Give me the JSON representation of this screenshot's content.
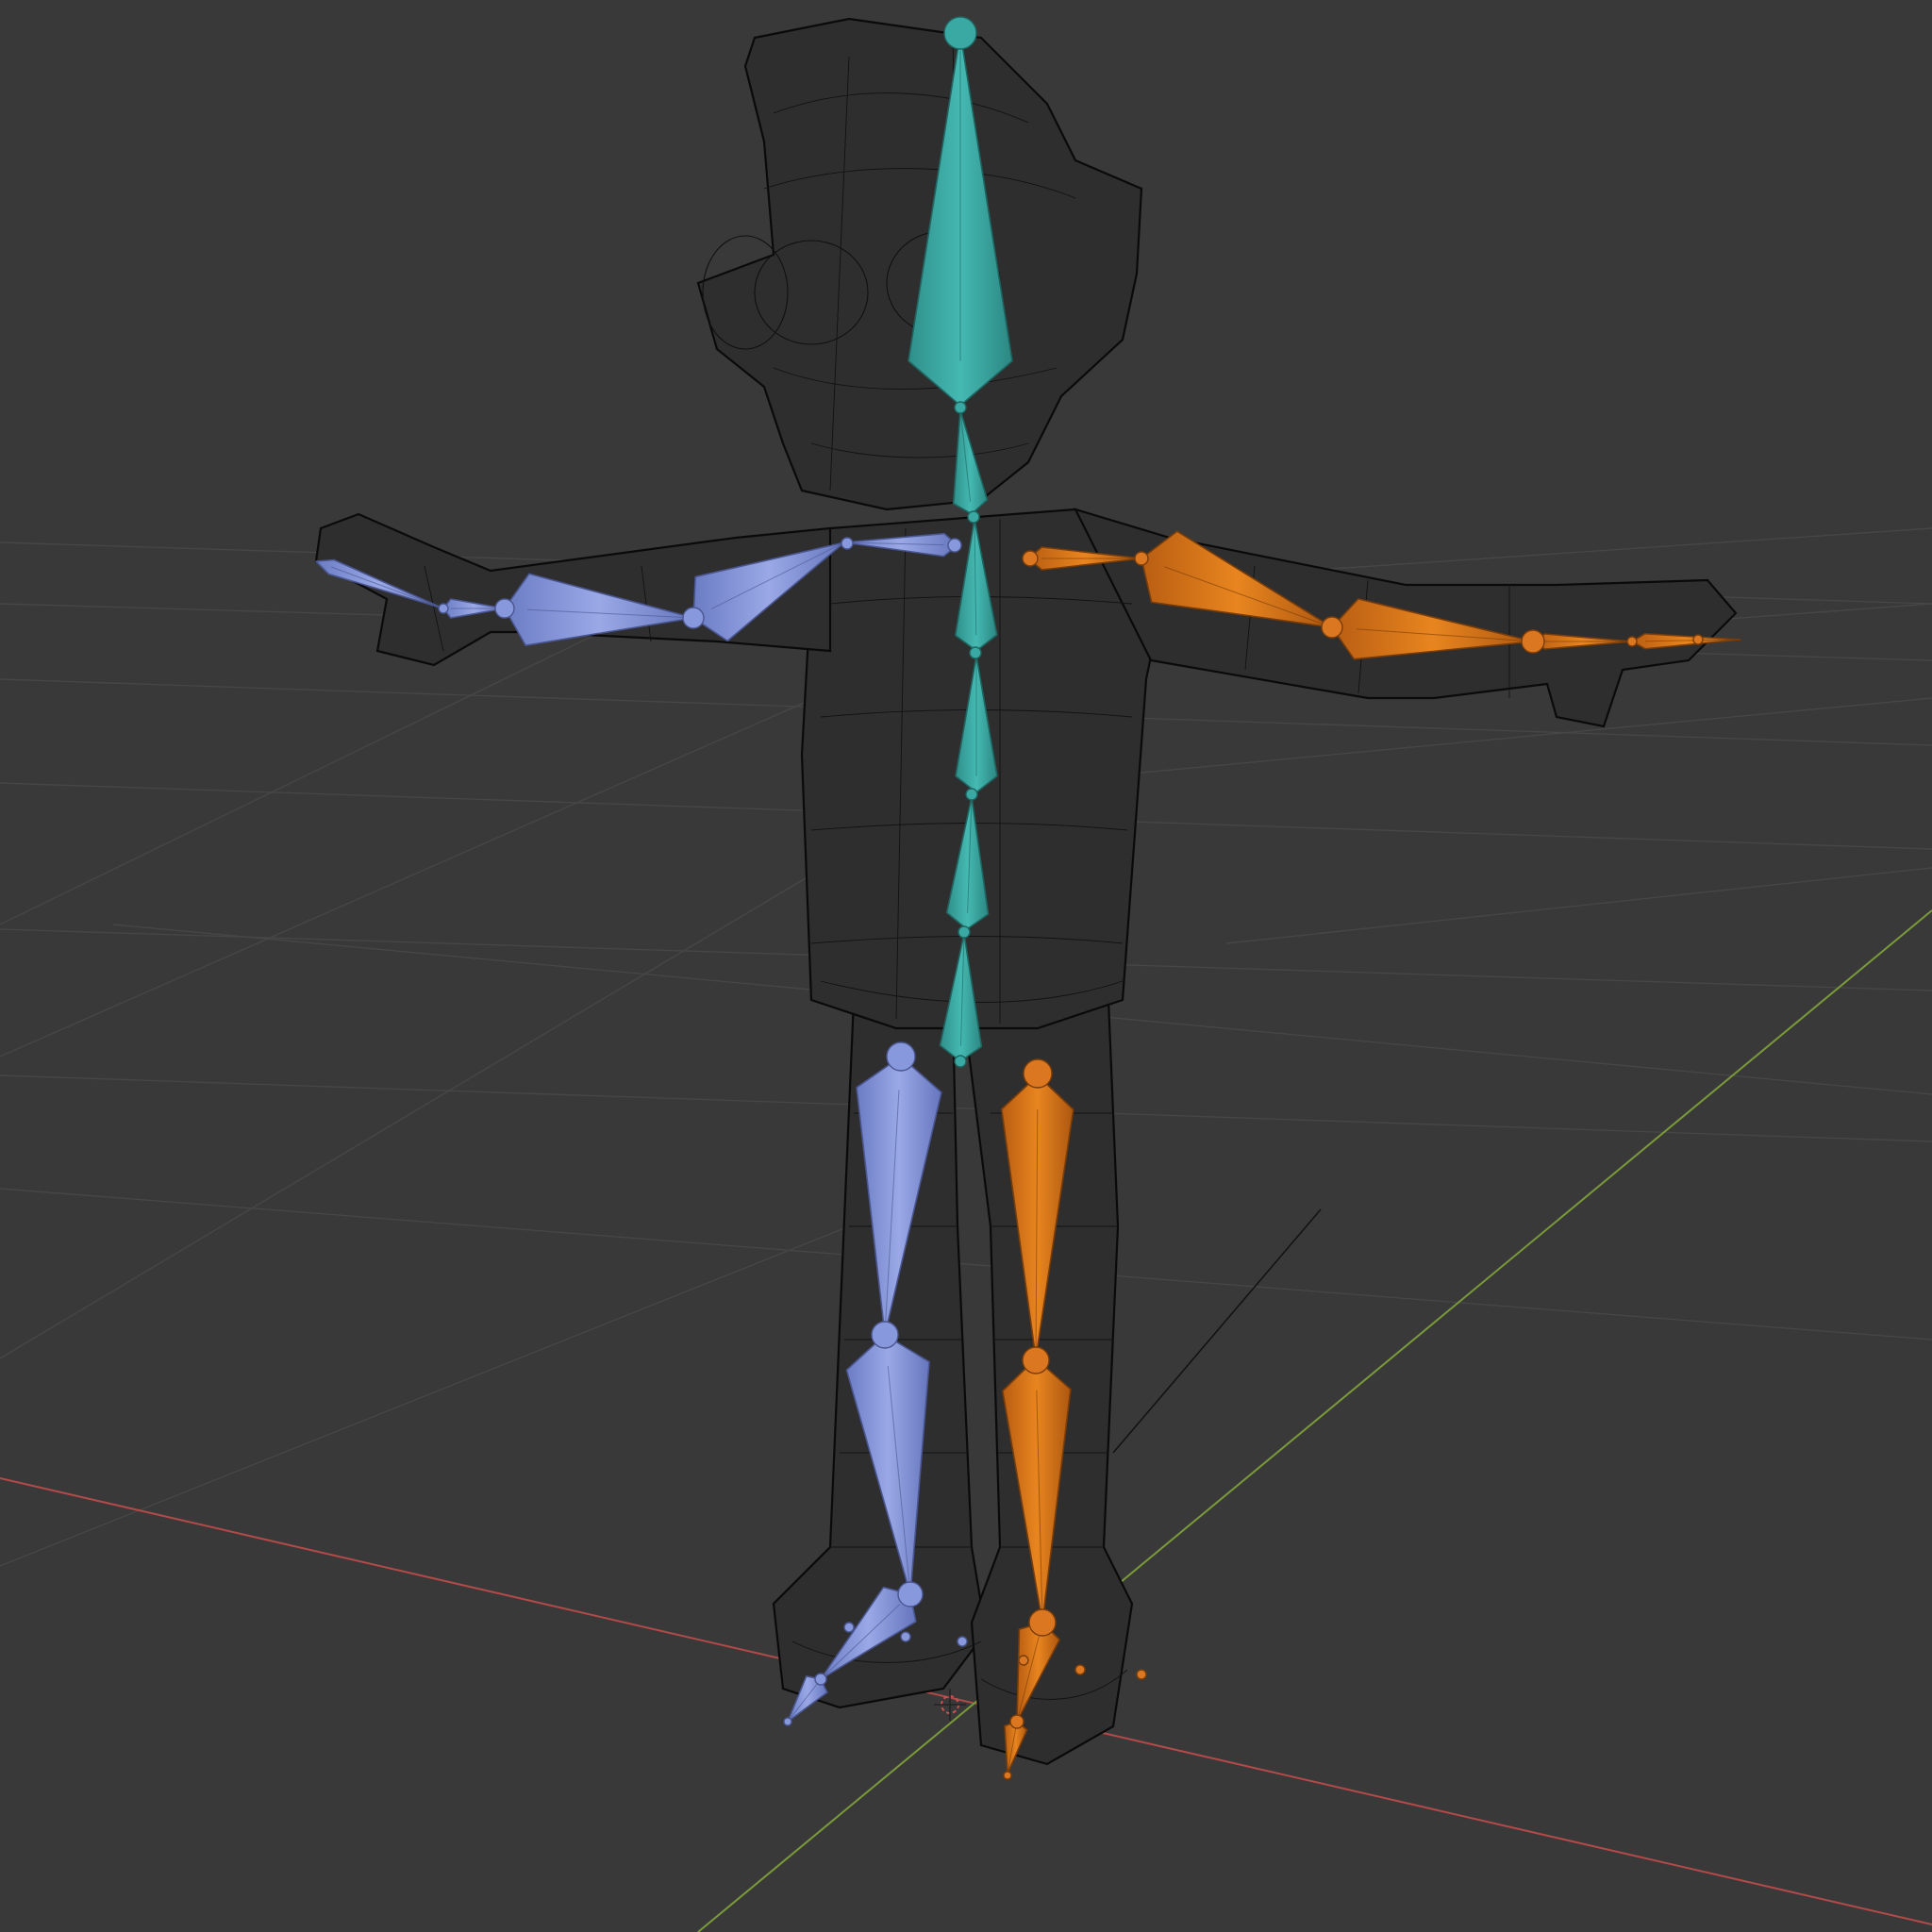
{
  "scene": {
    "description_icons": [
      "armature-icon",
      "mesh-wireframe-icon",
      "3d-cursor-icon"
    ],
    "colors": {
      "background": "#393939",
      "grid": "#464646",
      "x_axis": "#b34a4a",
      "y_axis": "#7a9a3a",
      "wireframe": "#101010",
      "bone_center": "#3aa9a3",
      "bone_left": "#7f90d6",
      "bone_right": "#d9731c"
    },
    "bone_groups": [
      {
        "id": "spine",
        "color": "#3aa9a3"
      },
      {
        "id": "left",
        "color": "#7f90d6"
      },
      {
        "id": "right",
        "color": "#d9731c"
      }
    ]
  }
}
